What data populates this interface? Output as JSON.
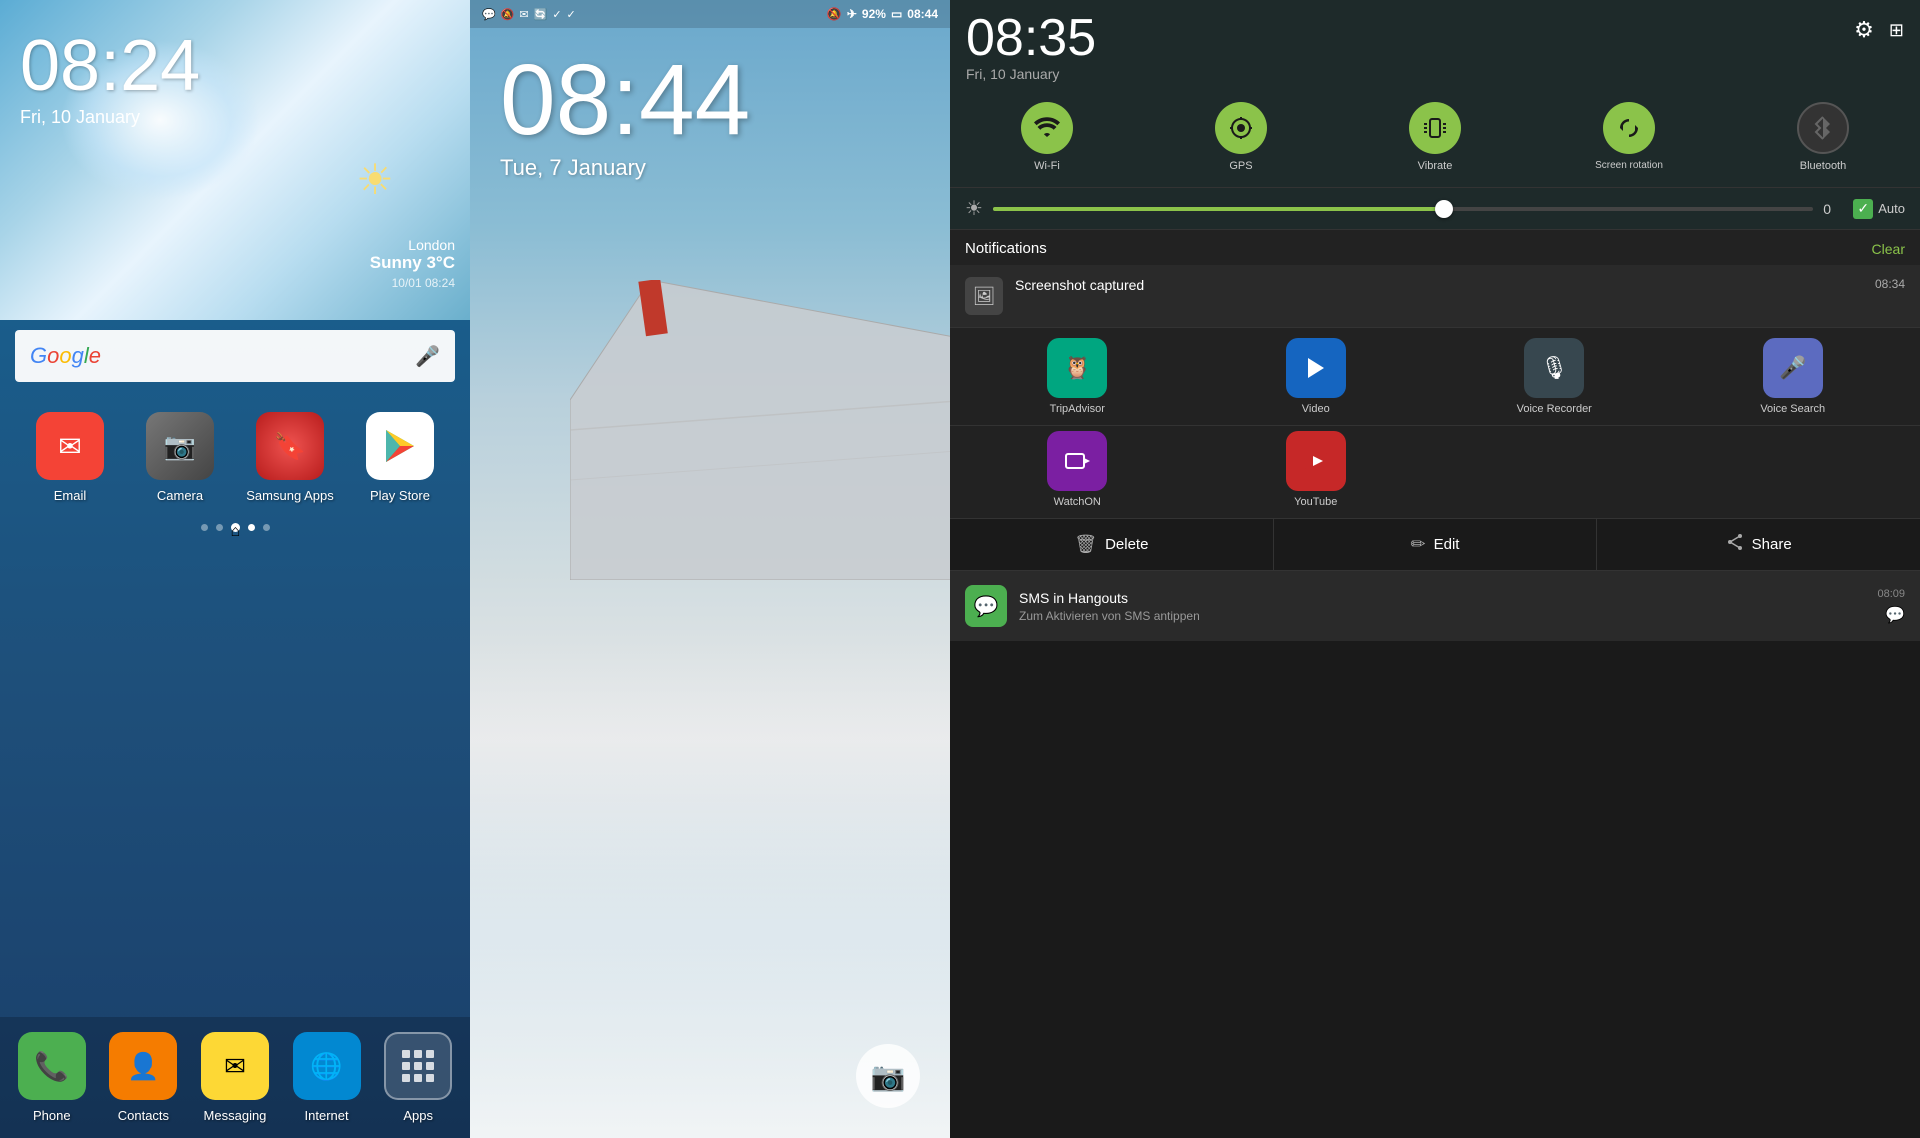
{
  "panel1": {
    "status_left_icons": [
      "photo-icon",
      "hangouts-icon"
    ],
    "status_right_icons": [
      "brightness-icon",
      "wifi-icon",
      "signal-icon",
      "battery-icon"
    ],
    "time": "08:24",
    "date": "Fri, 10 January",
    "weather": {
      "city": "London",
      "desc": "Sunny",
      "temp": "3°C",
      "datetime": "10/01 08:24"
    },
    "search_placeholder": "Google",
    "apps": [
      {
        "label": "Email",
        "icon": "email"
      },
      {
        "label": "Camera",
        "icon": "camera"
      },
      {
        "label": "Samsung Apps",
        "icon": "samsung-apps"
      },
      {
        "label": "Play Store",
        "icon": "play-store"
      }
    ],
    "dock": [
      {
        "label": "Phone",
        "icon": "phone"
      },
      {
        "label": "Contacts",
        "icon": "contacts"
      },
      {
        "label": "Messaging",
        "icon": "messaging"
      },
      {
        "label": "Internet",
        "icon": "internet"
      },
      {
        "label": "Apps",
        "icon": "apps"
      }
    ]
  },
  "panel2": {
    "status_icons": [
      "hangouts",
      "mute",
      "email",
      "sync",
      "check",
      "check2"
    ],
    "status_right": [
      "mute",
      "airplane",
      "92%",
      "battery",
      "08:44"
    ],
    "time": "08:44",
    "date": "Tue, 7 January"
  },
  "panel3": {
    "time": "08:35",
    "date": "Fri, 10 January",
    "toggles": [
      {
        "label": "Wi-Fi",
        "active": true,
        "icon": "wifi"
      },
      {
        "label": "GPS",
        "active": true,
        "icon": "gps"
      },
      {
        "label": "Vibrate",
        "active": true,
        "icon": "vibrate"
      },
      {
        "label": "Screen rotation",
        "active": true,
        "icon": "rotation"
      },
      {
        "label": "Bluetooth",
        "active": false,
        "icon": "bluetooth"
      }
    ],
    "brightness": {
      "value": "0",
      "auto_label": "Auto",
      "percent": 55
    },
    "notifications_title": "Notifications",
    "clear_label": "Clear",
    "screenshot_notif": {
      "title": "Screenshot captured",
      "time": "08:34"
    },
    "shortcuts": [
      {
        "label": "TripAdvisor",
        "icon": "tripadvisor"
      },
      {
        "label": "Video",
        "icon": "video"
      },
      {
        "label": "Voice Recorder",
        "icon": "voice-recorder"
      },
      {
        "label": "Voice Search",
        "icon": "voice-search"
      },
      {
        "label": "WatchON",
        "icon": "watchon"
      },
      {
        "label": "YouTube",
        "icon": "youtube"
      }
    ],
    "actions": [
      {
        "label": "Delete",
        "icon": "trash"
      },
      {
        "label": "Edit",
        "icon": "pencil"
      },
      {
        "label": "Share",
        "icon": "share"
      }
    ],
    "sms": {
      "title": "SMS in Hangouts",
      "body": "Zum Aktivieren von SMS antippen",
      "time": "08:09"
    }
  }
}
